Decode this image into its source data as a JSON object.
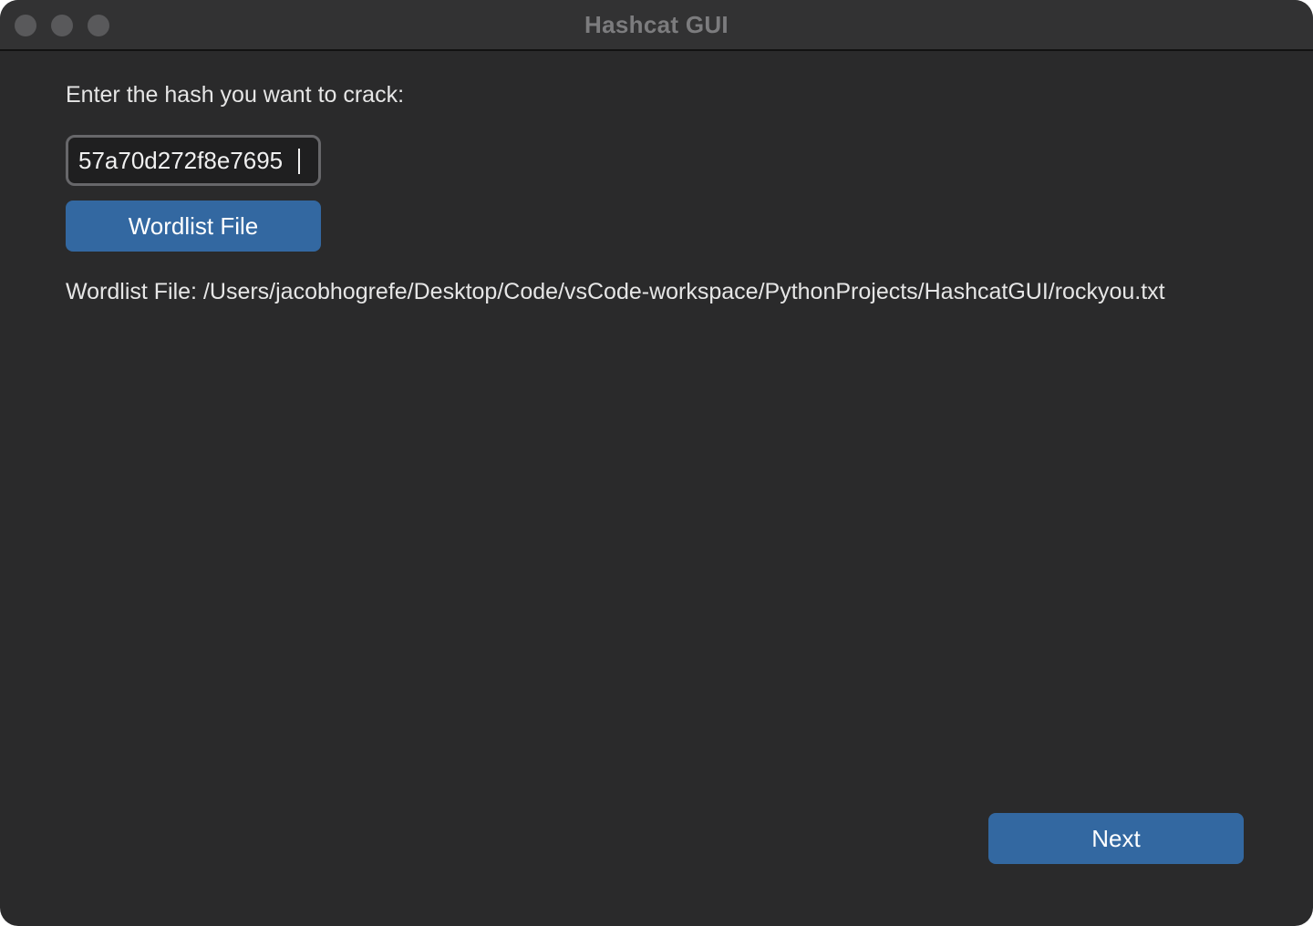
{
  "window": {
    "title": "Hashcat GUI"
  },
  "form": {
    "prompt_label": "Enter the hash you want to crack:",
    "hash_value": "57a70d272f8e7695",
    "wordlist_button_label": "Wordlist File",
    "wordlist_path_text": "Wordlist File: /Users/jacobhogrefe/Desktop/Code/vsCode-workspace/PythonProjects/HashcatGUI/rockyou.txt",
    "next_button_label": "Next"
  },
  "colors": {
    "window_background": "#2a2a2b",
    "button_accent": "#3368a1",
    "traffic_light_inactive": "#59595b"
  }
}
